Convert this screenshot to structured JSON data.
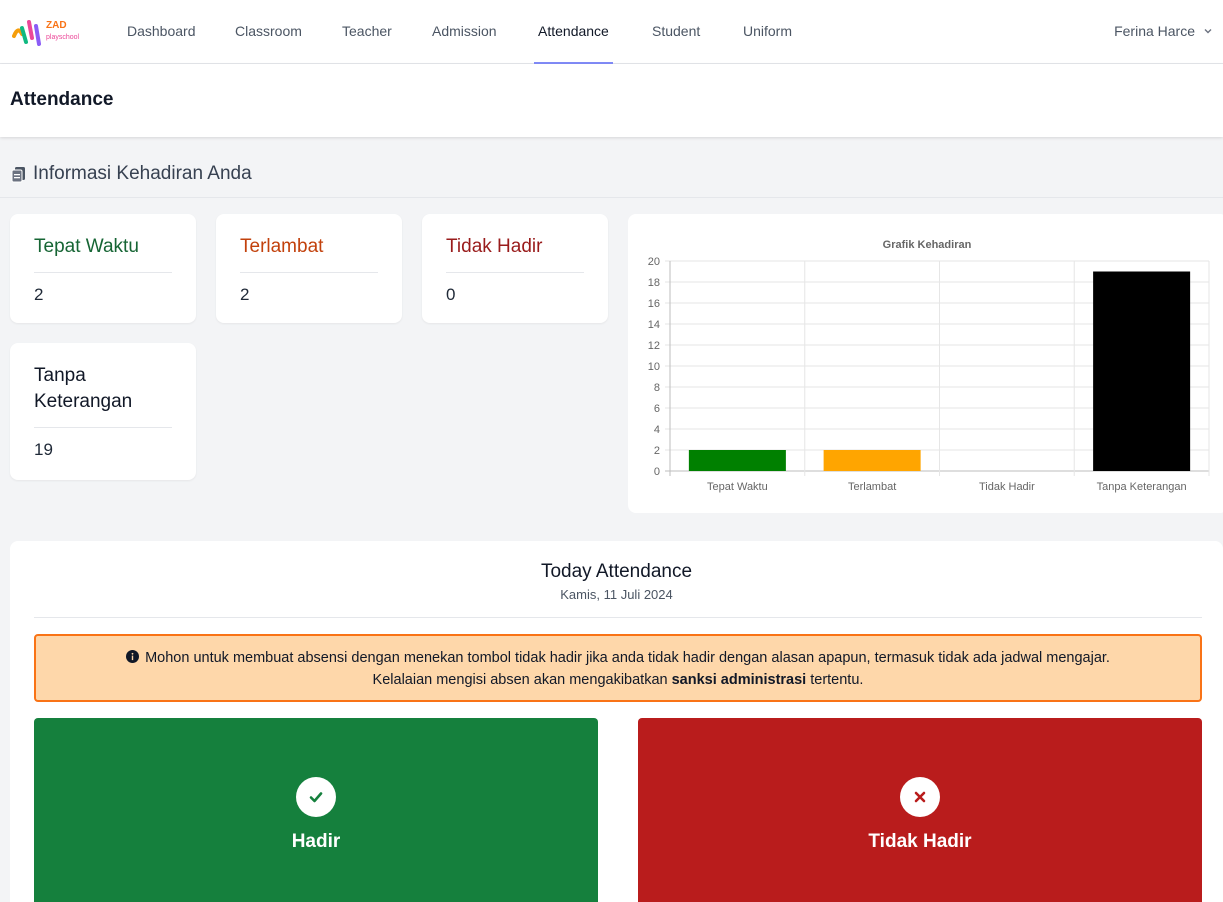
{
  "nav": {
    "logo_text": "ZAD playschool",
    "links": [
      "Dashboard",
      "Classroom",
      "Teacher",
      "Admission",
      "Attendance",
      "Student",
      "Uniform"
    ],
    "active": "Attendance",
    "user_name": "Ferina Harce"
  },
  "page": {
    "title": "Attendance"
  },
  "section": {
    "title": "Informasi Kehadiran Anda",
    "icon": "clipboard-icon"
  },
  "stats": [
    {
      "label": "Tepat Waktu",
      "value": "2",
      "color": "#166534"
    },
    {
      "label": "Terlambat",
      "value": "2",
      "color": "#c2410c"
    },
    {
      "label": "Tidak Hadir",
      "value": "0",
      "color": "#991b1b"
    },
    {
      "label": "Tanpa Keterangan",
      "value": "19",
      "color": "#111827"
    }
  ],
  "chart_data": {
    "type": "bar",
    "title": "Grafik Kehadiran",
    "categories": [
      "Tepat Waktu",
      "Terlambat",
      "Tidak Hadir",
      "Tanpa Keterangan"
    ],
    "values": [
      2,
      2,
      0,
      19
    ],
    "colors": [
      "#008000",
      "#ffa500",
      "#ff0000",
      "#000000"
    ],
    "ylim": [
      0,
      20
    ],
    "yticks": [
      0,
      2,
      4,
      6,
      8,
      10,
      12,
      14,
      16,
      18,
      20
    ],
    "grid": true,
    "legend": "none"
  },
  "today": {
    "title": "Today Attendance",
    "date": "Kamis, 11 Juli 2024",
    "notice_line1": "Mohon untuk membuat absensi dengan menekan tombol tidak hadir jika anda tidak hadir dengan alasan apapun, termasuk tidak ada jadwal mengajar.",
    "notice_line2_pre": "Kelalaian mengisi absen akan mengakibatkan ",
    "notice_line2_bold": "sanksi administrasi",
    "notice_line2_post": " tertentu.",
    "present_label": "Hadir",
    "absent_label": "Tidak Hadir",
    "present_color": "#15803d",
    "absent_color": "#b91c1c"
  }
}
